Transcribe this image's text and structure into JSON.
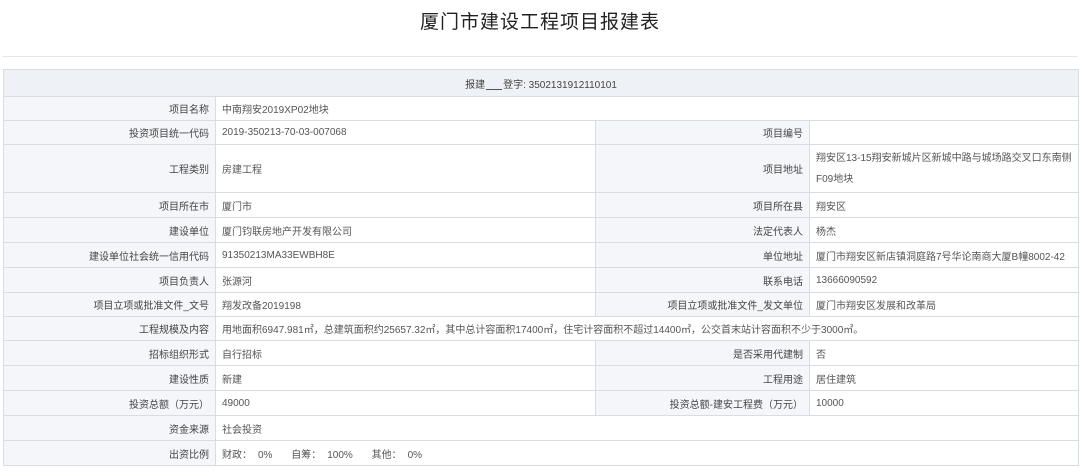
{
  "page": {
    "title": "厦门市建设工程项目报建表"
  },
  "registration": {
    "prefix": "报建",
    "suffix": "登字:",
    "number": "3502131912110101"
  },
  "fields": {
    "project_name": {
      "label": "项目名称",
      "value": "中南翔安2019XP02地块"
    },
    "invest_code": {
      "label": "投资项目统一代码",
      "value": "2019-350213-70-03-007068"
    },
    "project_no": {
      "label": "项目编号",
      "value": ""
    },
    "eng_category": {
      "label": "工程类别",
      "value": "房建工程"
    },
    "project_address": {
      "label": "项目地址",
      "value": "翔安区13-15翔安新城片区新城中路与城场路交叉口东南侧F09地块"
    },
    "city": {
      "label": "项目所在市",
      "value": "厦门市"
    },
    "county": {
      "label": "项目所在县",
      "value": "翔安区"
    },
    "builder": {
      "label": "建设单位",
      "value": "厦门钧联房地产开发有限公司"
    },
    "legal_rep": {
      "label": "法定代表人",
      "value": "杨杰"
    },
    "credit_code": {
      "label": "建设单位社会统一信用代码",
      "value": "91350213MA33EWBH8E"
    },
    "unit_address": {
      "label": "单位地址",
      "value": "厦门市翔安区新店镇洞庭路7号华论南商大厦B幢8002-42"
    },
    "manager": {
      "label": "项目负责人",
      "value": "张源河"
    },
    "phone": {
      "label": "联系电话",
      "value": "13666090592"
    },
    "approval_doc": {
      "label": "项目立项或批准文件_文号",
      "value": "翔发改备2019198"
    },
    "approval_unit": {
      "label": "项目立项或批准文件_发文单位",
      "value": "厦门市翔安区发展和改革局"
    },
    "scale": {
      "label": "工程规模及内容",
      "value": "用地面积6947.981㎡，总建筑面积约25657.32㎡，其中总计容面积17400㎡，住宅计容面积不超过14400㎡，公交首末站计容面积不少于3000㎡。"
    },
    "tender_form": {
      "label": "招标组织形式",
      "value": "自行招标"
    },
    "agent_system": {
      "label": "是否采用代建制",
      "value": "否"
    },
    "nature": {
      "label": "建设性质",
      "value": "新建"
    },
    "usage": {
      "label": "工程用途",
      "value": "居住建筑"
    },
    "total_invest": {
      "label": "投资总额（万元）",
      "value": "49000"
    },
    "construct_cost": {
      "label": "投资总额-建安工程费（万元）",
      "value": "10000"
    },
    "fund_source": {
      "label": "资金来源",
      "value": "社会投资"
    },
    "ratio": {
      "label": "出资比例",
      "finance_label": "财政：",
      "finance_value": "0%",
      "self_label": "自筹：",
      "self_value": "100%",
      "other_label": "其他：",
      "other_value": "0%"
    }
  }
}
